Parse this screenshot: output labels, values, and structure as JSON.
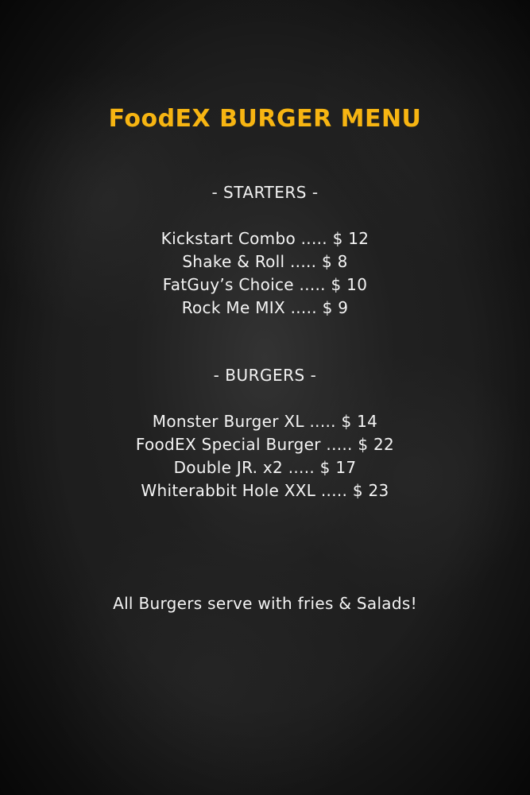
{
  "menu": {
    "title": "FoodEX BURGER MENU",
    "sections": [
      {
        "heading": "- STARTERS -",
        "items": [
          "Kickstart Combo ..... $ 12",
          "Shake & Roll ..... $ 8",
          "FatGuy’s Choice ..... $ 10",
          "Rock Me MIX ..... $ 9"
        ]
      },
      {
        "heading": "- BURGERS -",
        "items": [
          "Monster Burger XL ..... $ 14",
          "FoodEX Special Burger ..... $ 22",
          "Double JR. x2 ..... $ 17",
          "Whiterabbit Hole XXL ..... $ 23"
        ]
      }
    ],
    "footer_note": "All Burgers serve with fries & Salads!"
  },
  "colors": {
    "background": "#1c1c1c",
    "title": "#f7b512",
    "text": "#f4f4f4"
  }
}
